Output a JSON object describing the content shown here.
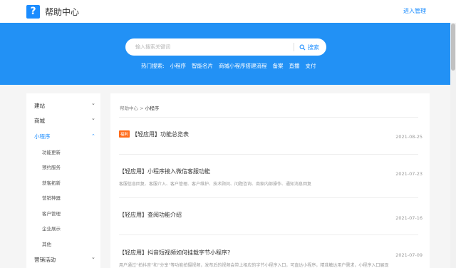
{
  "header": {
    "logo_glyph": "?",
    "title": "帮助中心",
    "admin_link": "进入管理"
  },
  "hero": {
    "search_placeholder": "输入搜索关键词",
    "search_button": "搜索",
    "hot_label": "热门搜索:",
    "hot_terms": [
      "小程序",
      "智能名片",
      "商城小程序搭建流程",
      "备案",
      "直播",
      "支付"
    ]
  },
  "sidebar": {
    "items": [
      {
        "label": "建站",
        "chevron": "⌄"
      },
      {
        "label": "商城",
        "chevron": "⌄"
      },
      {
        "label": "小程序",
        "chevron": "⌃"
      },
      {
        "label": "营销活动",
        "chevron": "⌄"
      }
    ],
    "subitems": [
      "功能更新",
      "预约服务",
      "获客拓新",
      "营销神器",
      "客户管理",
      "企业展示",
      "其他"
    ]
  },
  "content": {
    "breadcrumb": {
      "home": "帮助中心",
      "sep": ">",
      "current": "小程序"
    },
    "articles": [
      {
        "tag": "福利",
        "title": "【轻应用】功能总览表",
        "desc": "",
        "date": "2021-08-25"
      },
      {
        "tag": "",
        "title": "【轻应用】小程序接入微信客服功能",
        "desc": "客服信息回复、客服介入、客户管理、客户维护、技术顾问、问题咨询、商家内部操作、通知消息回复、客户转移、数据统计、客服备注、客服评价、客服管理、客服分配",
        "date": "2021-07-23"
      },
      {
        "tag": "",
        "title": "【轻应用】查阅功能介绍",
        "desc": "",
        "date": "2021-07-16"
      },
      {
        "tag": "",
        "title": "【轻应用】抖音短视频如何挂载字节小程序?",
        "desc": "用户通过“拍抖音”和“分享”等功能拍摄视频，发布后的视频会带上相应的字节小程序入口，可直达小程序，精准触达用户需求，小程序入口展现",
        "date": "2021-07-09"
      }
    ]
  },
  "colors": {
    "brand": "#2291f5",
    "accent": "#1a8cff",
    "tag": "#ff6b1a"
  }
}
